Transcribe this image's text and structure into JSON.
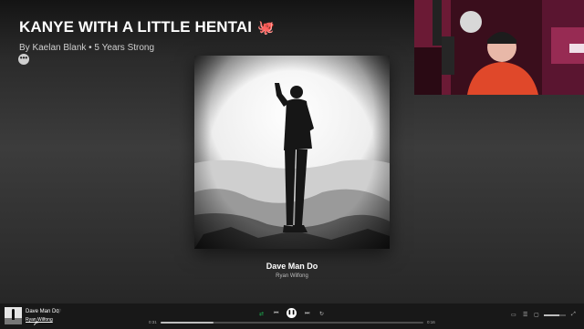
{
  "playlist": {
    "title": "KANYE WITH A LITTLE HENTAI",
    "title_emoji": "🐙",
    "subtitle": "By Kaelan Blank • 5 Years Strong",
    "more_label": "•••"
  },
  "now_playing_view": {
    "track_title": "Dave Man Do",
    "track_artist": "Ryan Wilfong"
  },
  "player_bar": {
    "track_title": "Dave Man Do",
    "track_artist": "Ryan Wilfong",
    "elapsed": "0:31",
    "duration": "0:16",
    "progress_fraction": 0.2,
    "volume_fraction": 0.7,
    "icons": {
      "heart": "heart-icon",
      "shuffle": "shuffle-icon",
      "previous": "previous-icon",
      "play_pause": "pause-icon",
      "next": "next-icon",
      "repeat": "repeat-icon",
      "lyrics": "lyrics-icon",
      "queue": "queue-icon",
      "devices": "devices-icon",
      "volume": "volume-icon",
      "fullscreen": "fullscreen-icon"
    }
  },
  "colors": {
    "accent": "#1db954",
    "bar_bg": "#181818",
    "emoji": "#f26a1b"
  }
}
